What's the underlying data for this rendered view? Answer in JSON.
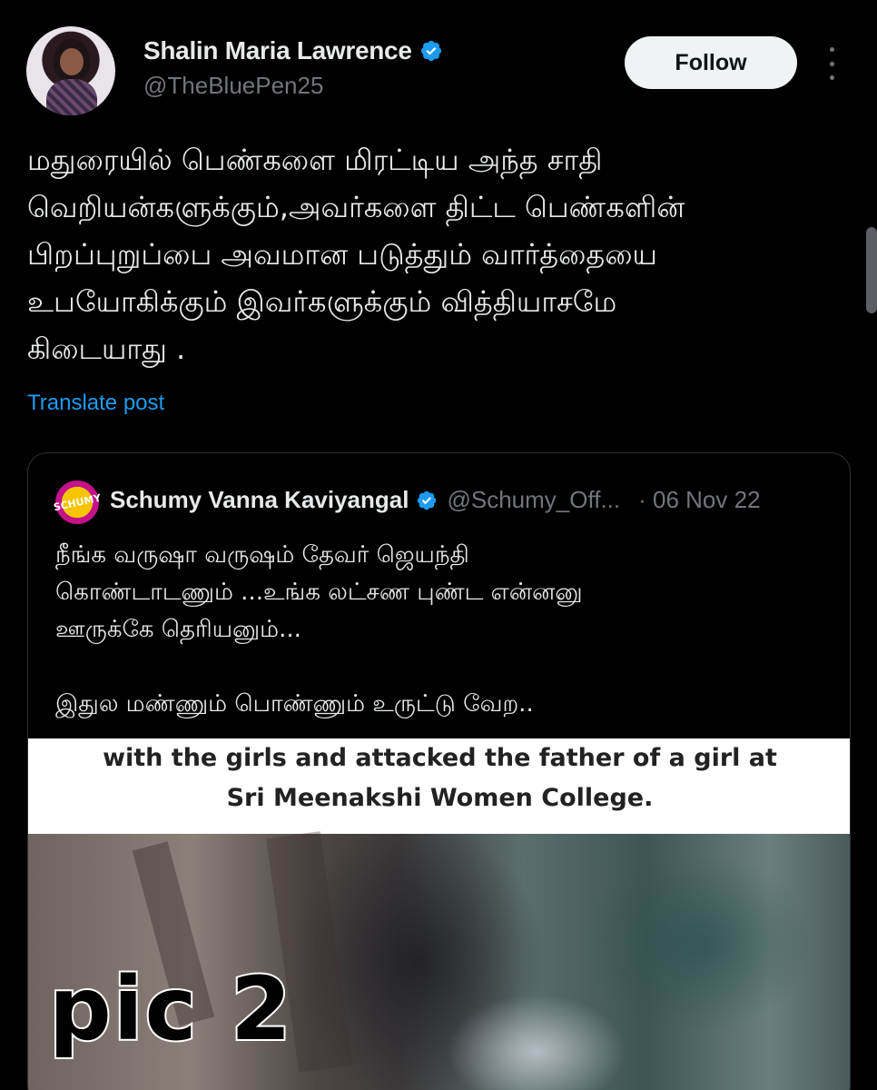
{
  "author": {
    "name": "Shalin Maria Lawrence",
    "handle": "@TheBluePen25",
    "verified_icon": "verified-badge-icon",
    "follow_label": "Follow"
  },
  "post": {
    "text": "மதுரையில் பெண்களை மிரட்டிய அந்த சாதி\nவெறியன்களுக்கும்,அவர்களை திட்ட பெண்களின்\nபிறப்புறுப்பை அவமான படுத்தும் வார்த்தையை\nஉபயோகிக்கும் இவர்களுக்கும் வித்தியாசமே\nகிடையாது .",
    "translate_label": "Translate post"
  },
  "quoted": {
    "avatar_text": "SCHUMY",
    "name": "Schumy Vanna Kaviyangal",
    "handle": "@Schumy_Off...",
    "date": "· 06 Nov 22",
    "text": "நீங்க வருஷா வருஷம் தேவர் ஜெயந்தி\nகொண்டாடணும் ...உங்க லட்சண புண்ட என்னனு\nஊருக்கே தெரியனும்...\n\nஇதுல மண்ணும் பொண்ணும் உருட்டு வேற..",
    "media_caption_line1": "with the girls and attacked the father of a girl at",
    "media_caption_line2": "Sri Meenakshi Women College."
  },
  "overlay_label": "pic 2",
  "colors": {
    "background": "#000000",
    "link": "#1d9bf0",
    "verified": "#1d9bf0",
    "secondary_text": "#71767b"
  }
}
